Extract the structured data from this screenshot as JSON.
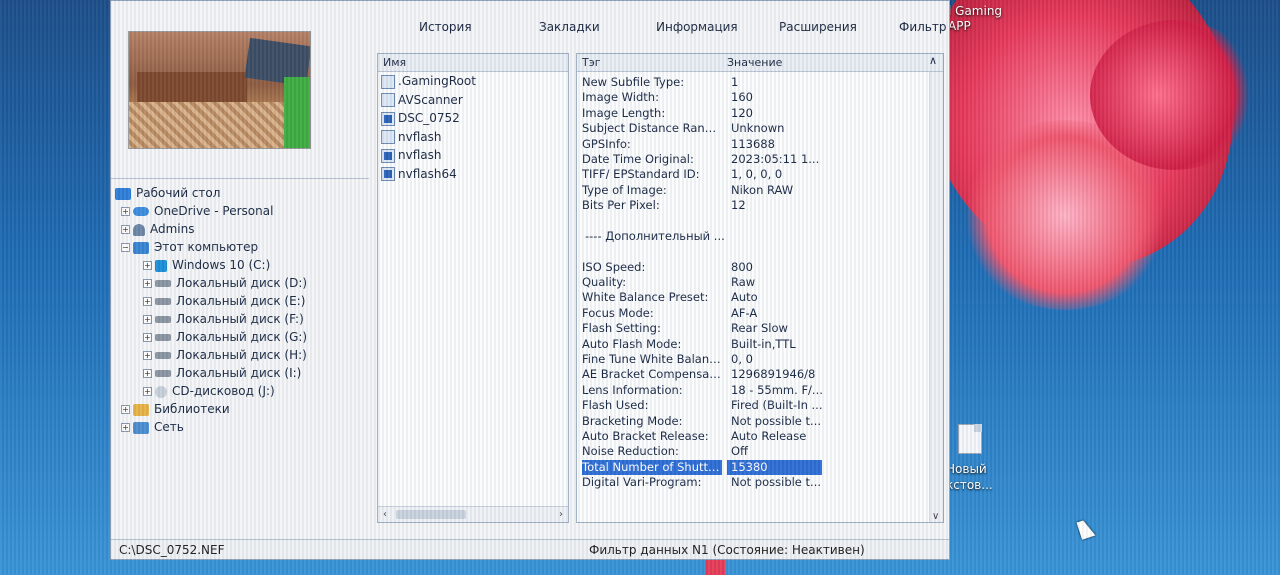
{
  "desktop": {
    "gaming_label_1": "l Gaming",
    "gaming_label_2": "APP",
    "newdoc_label_1": "Новый",
    "newdoc_label_2": "кстов..."
  },
  "tabs": [
    "История",
    "Закладки",
    "Информация",
    "Расширения",
    "Фильтр"
  ],
  "tree": [
    {
      "label": "Рабочий стол",
      "icon": "desktop-icon",
      "depth": 0,
      "expander": ""
    },
    {
      "label": "OneDrive - Personal",
      "icon": "cloud-icon",
      "depth": 1,
      "expander": "+"
    },
    {
      "label": "Admins",
      "icon": "user-icon",
      "depth": 1,
      "expander": "+"
    },
    {
      "label": "Этот компьютер",
      "icon": "computer-icon",
      "depth": 1,
      "expander": "−"
    },
    {
      "label": "Windows 10 (C:)",
      "icon": "windows-drive-icon",
      "depth": 2,
      "expander": "+"
    },
    {
      "label": "Локальный диск (D:)",
      "icon": "drive-icon",
      "depth": 2,
      "expander": "+"
    },
    {
      "label": "Локальный диск (E:)",
      "icon": "drive-icon",
      "depth": 2,
      "expander": "+"
    },
    {
      "label": "Локальный диск (F:)",
      "icon": "drive-icon",
      "depth": 2,
      "expander": "+"
    },
    {
      "label": "Локальный диск (G:)",
      "icon": "drive-icon",
      "depth": 2,
      "expander": "+"
    },
    {
      "label": "Локальный диск (H:)",
      "icon": "drive-icon",
      "depth": 2,
      "expander": "+"
    },
    {
      "label": "Локальный диск (I:)",
      "icon": "drive-icon",
      "depth": 2,
      "expander": "+"
    },
    {
      "label": "CD-дисковод (J:)",
      "icon": "cd-drive-icon",
      "depth": 2,
      "expander": "+"
    },
    {
      "label": "Библиотеки",
      "icon": "library-icon",
      "depth": 1,
      "expander": "+"
    },
    {
      "label": "Сеть",
      "icon": "network-icon",
      "depth": 1,
      "expander": "+"
    }
  ],
  "filelist": {
    "header": "Имя",
    "items": [
      {
        "name": ".GamingRoot",
        "icon": "file-icon"
      },
      {
        "name": "AVScanner",
        "icon": "file-icon"
      },
      {
        "name": "DSC_0752",
        "icon": "image-file-icon"
      },
      {
        "name": "nvflash",
        "icon": "file-icon"
      },
      {
        "name": "nvflash",
        "icon": "image-file-icon"
      },
      {
        "name": "nvflash64",
        "icon": "image-file-icon"
      }
    ]
  },
  "tagtable": {
    "header_tag": "Тэг",
    "header_value": "Значение",
    "rows": [
      {
        "tag": "New Subfile Type:",
        "value": "1"
      },
      {
        "tag": "Image Width:",
        "value": "160"
      },
      {
        "tag": "Image Length:",
        "value": "120"
      },
      {
        "tag": "Subject Distance Range:",
        "value": "Unknown"
      },
      {
        "tag": "GPSInfo:",
        "value": "113688"
      },
      {
        "tag": "Date Time Original:",
        "value": "2023:05:11 1..."
      },
      {
        "tag": "TIFF/ EPStandard ID:",
        "value": "1, 0, 0, 0"
      },
      {
        "tag": "Type of Image:",
        "value": "Nikon RAW"
      },
      {
        "tag": "Bits Per Pixel:",
        "value": "12"
      }
    ],
    "section_label": "---- Дополнительный ...",
    "rows2": [
      {
        "tag": "ISO Speed:",
        "value": "800"
      },
      {
        "tag": "Quality:",
        "value": "Raw"
      },
      {
        "tag": "White Balance Preset:",
        "value": "Auto"
      },
      {
        "tag": "Focus Mode:",
        "value": "AF-A"
      },
      {
        "tag": "Flash Setting:",
        "value": "Rear Slow"
      },
      {
        "tag": "Auto Flash Mode:",
        "value": "Built-in,TTL"
      },
      {
        "tag": "Fine Tune White Balanc...",
        "value": "0, 0"
      },
      {
        "tag": "AE Bracket Compensati...",
        "value": "1296891946/8"
      },
      {
        "tag": "Lens Information:",
        "value": "18 - 55mm. F/..."
      },
      {
        "tag": "Flash Used:",
        "value": "Fired (Built-In ..."
      },
      {
        "tag": "Bracketing Mode:",
        "value": "Not possible t..."
      },
      {
        "tag": "Auto Bracket Release:",
        "value": "Auto Release"
      },
      {
        "tag": "Noise Reduction:",
        "value": "Off"
      },
      {
        "tag": "Total Number of Shutte...",
        "value": "15380",
        "selected": true
      },
      {
        "tag": "Digital Vari-Program:",
        "value": "Not possible t..."
      }
    ]
  },
  "status": {
    "path": "C:\\DSC_0752.NEF",
    "filter": "Фильтр данных N1 (Состояние: Неактивен)"
  }
}
